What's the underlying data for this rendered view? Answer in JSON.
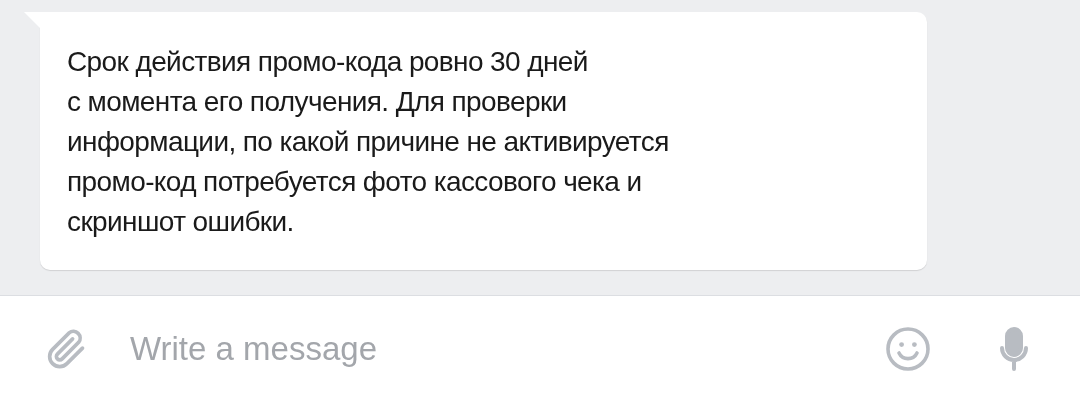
{
  "message": {
    "text": "Срок действия промо-кода ровно 30 дней\nс момента его получения. Для проверки\nинформации, по какой причине не активируется\nпромо-код потребуется фото кассового чека и\nскриншот ошибки."
  },
  "composer": {
    "placeholder": "Write a message"
  }
}
